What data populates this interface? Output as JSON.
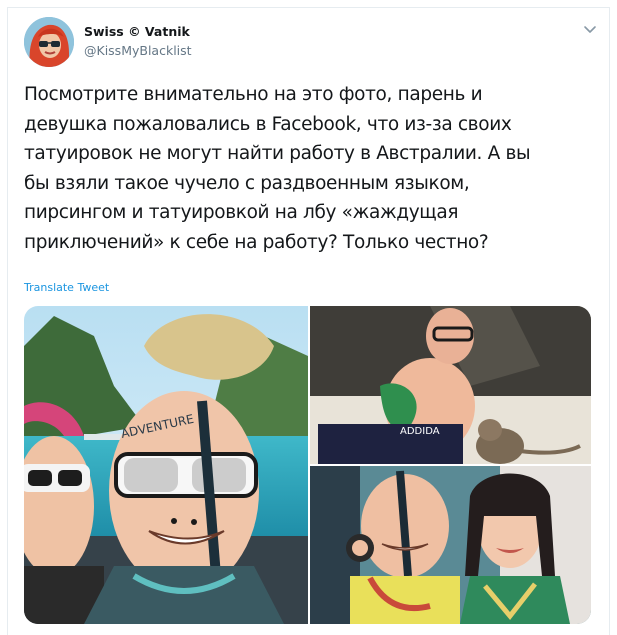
{
  "tweet": {
    "display_name": "Swiss © Vatnik",
    "handle": "@KissMyBlacklist",
    "text": "Посмотрите внимательно на это фото, парень и\nдевушка пожаловались в Facebook, что из-за своих\nтатуировок не могут найти работу в Австралии. А вы\nбы взяли такое чучело с раздвоенным языком,\nпирсингом и татуировкой на лбу «жаждущая\nприключений» к себе на работу? Только честно?",
    "translate_label": "Translate Tweet"
  },
  "icons": {
    "menu": "chevron-down-icon",
    "avatar": "avatar"
  },
  "colors": {
    "name": "#14171a",
    "secondary": "#657786",
    "link": "#1b95e0",
    "border": "#e6ecf0"
  },
  "media": {
    "photo_count": 3
  }
}
